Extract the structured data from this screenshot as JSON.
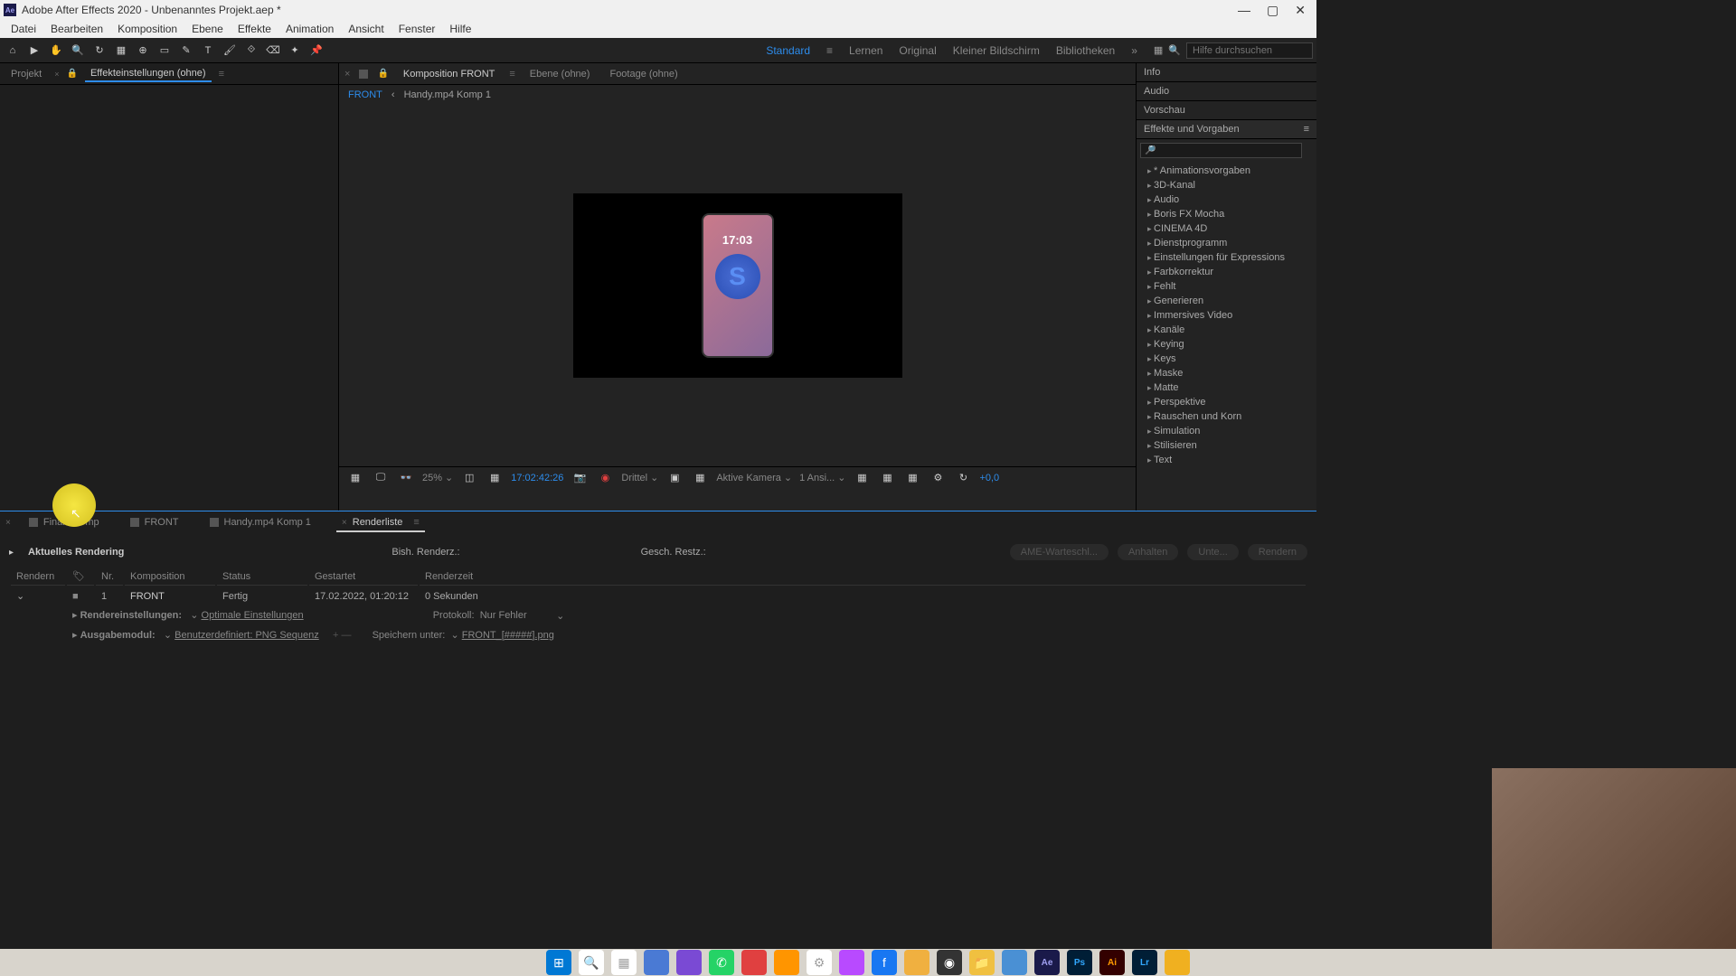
{
  "titlebar": {
    "app_abbrev": "Ae",
    "title": "Adobe After Effects 2020 - Unbenanntes Projekt.aep *"
  },
  "menu": [
    "Datei",
    "Bearbeiten",
    "Komposition",
    "Ebene",
    "Effekte",
    "Animation",
    "Ansicht",
    "Fenster",
    "Hilfe"
  ],
  "workspaces": {
    "items": [
      "Standard",
      "Lernen",
      "Original",
      "Kleiner Bildschirm",
      "Bibliotheken"
    ],
    "active": "Standard"
  },
  "search_placeholder": "Hilfe durchsuchen",
  "left_panel": {
    "tab1": "Projekt",
    "tab2": "Effekteinstellungen (ohne)"
  },
  "comp_panel": {
    "tab_label": "Komposition FRONT",
    "tab2": "Ebene (ohne)",
    "tab3": "Footage (ohne)",
    "bc1": "FRONT",
    "bc2": "Handy.mp4 Komp 1"
  },
  "phone_time": "17:03",
  "viewer_controls": {
    "zoom": "25%",
    "timecode": "17:02:42:26",
    "quality": "Drittel",
    "camera": "Aktive Kamera",
    "views": "1 Ansi...",
    "exposure": "+0,0"
  },
  "right_panel": {
    "sections": [
      "Info",
      "Audio",
      "Vorschau",
      "Effekte und Vorgaben"
    ],
    "effects": [
      "* Animationsvorgaben",
      "3D-Kanal",
      "Audio",
      "Boris FX Mocha",
      "CINEMA 4D",
      "Dienstprogramm",
      "Einstellungen für Expressions",
      "Farbkorrektur",
      "Fehlt",
      "Generieren",
      "Immersives Video",
      "Kanäle",
      "Keying",
      "Keys",
      "Maske",
      "Matte",
      "Perspektive",
      "Rauschen und Korn",
      "Simulation",
      "Stilisieren",
      "Text"
    ]
  },
  "bottom_tabs": [
    "Finale Komp",
    "FRONT",
    "Handy.mp4 Komp 1",
    "Renderliste"
  ],
  "render": {
    "current_label": "Aktuelles Rendering",
    "prev_label": "Bish. Renderz.:",
    "est_label": "Gesch. Restz.:",
    "btn_ame": "AME-Warteschl...",
    "btn_pause": "Anhalten",
    "btn_stop": "Unte...",
    "btn_render": "Rendern",
    "cols": {
      "render": "Rendern",
      "nr": "Nr.",
      "komp": "Komposition",
      "status": "Status",
      "started": "Gestartet",
      "rendertime": "Renderzeit"
    },
    "row": {
      "nr": "1",
      "komp": "FRONT",
      "status": "Fertig",
      "started": "17.02.2022, 01:20:12",
      "rendertime": "0 Sekunden"
    },
    "settings_label": "Rendereinstellungen:",
    "settings_value": "Optimale Einstellungen",
    "protocol_label": "Protokoll:",
    "protocol_value": "Nur Fehler",
    "output_label": "Ausgabemodul:",
    "output_value": "Benutzerdefiniert: PNG Sequenz",
    "save_label": "Speichern unter:",
    "save_value": "FRONT_[#####].png"
  }
}
